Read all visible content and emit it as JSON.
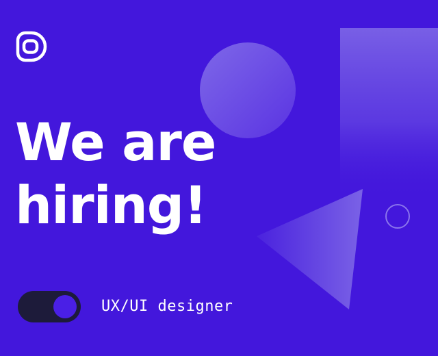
{
  "headline": {
    "line1": "We are",
    "line2": "hiring!"
  },
  "role": {
    "label": "UX/UI designer",
    "toggle_state": "on"
  },
  "colors": {
    "background": "#4317dc",
    "text": "#ffffff",
    "toggle_track": "#1d1b3a",
    "toggle_knob": "#4a1fe6"
  },
  "icons": {
    "logo": "brand-logo-icon"
  }
}
